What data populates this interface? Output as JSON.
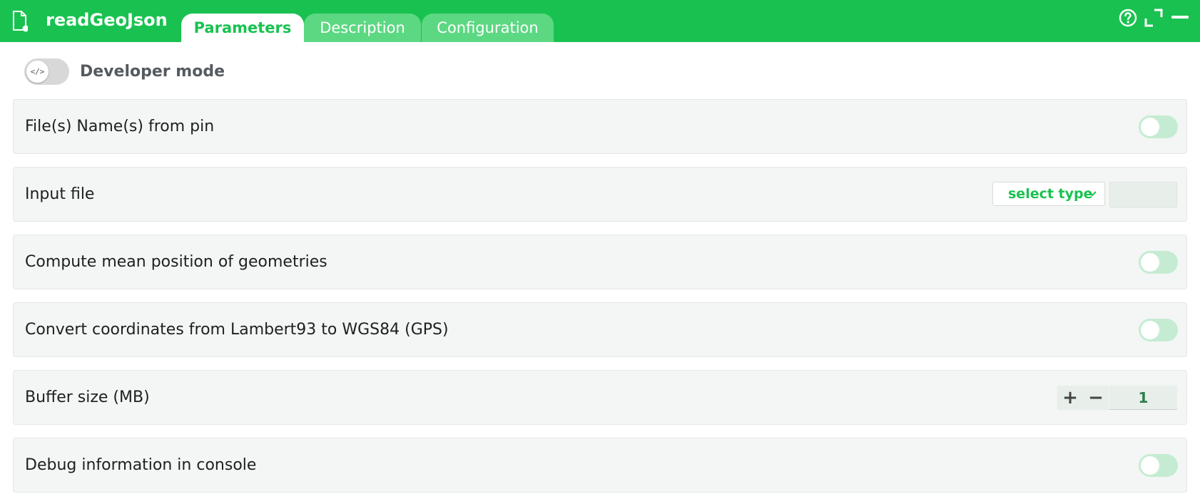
{
  "header": {
    "title": "readGeoJson",
    "tabs": [
      {
        "label": "Parameters",
        "active": true
      },
      {
        "label": "Description",
        "active": false
      },
      {
        "label": "Configuration",
        "active": false
      }
    ],
    "icons": [
      "file-icon",
      "help-icon",
      "expand-icon",
      "minimize-icon"
    ]
  },
  "developer_mode": {
    "label": "Developer mode",
    "toggle_glyph": "</>",
    "enabled": false
  },
  "parameters": {
    "files_from_pin": {
      "label": "File(s) Name(s) from pin",
      "enabled": false
    },
    "input_file": {
      "label": "Input file",
      "select_label": "select type",
      "value": ""
    },
    "compute_mean": {
      "label": "Compute mean position of geometries",
      "enabled": false
    },
    "convert_coords": {
      "label": "Convert coordinates from Lambert93 to WGS84 (GPS)",
      "enabled": false
    },
    "buffer_size": {
      "label": "Buffer size (MB)",
      "value": "1",
      "plus": "+",
      "minus": "−"
    },
    "debug": {
      "label": "Debug information in console",
      "enabled": false
    }
  },
  "colors": {
    "brand": "#19c250",
    "tab_inactive": "#5cd882",
    "row_bg": "#f3f6f4",
    "toggle_off": "#c5ecd3"
  }
}
